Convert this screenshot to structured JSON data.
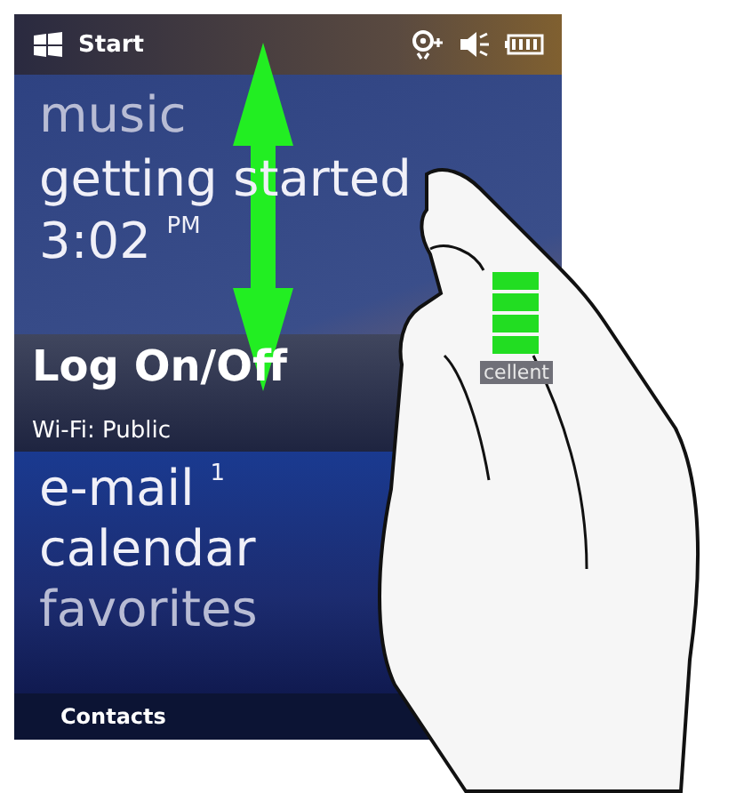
{
  "status_bar": {
    "title": "Start"
  },
  "items": [
    {
      "kind": "dim",
      "label": "music"
    },
    {
      "kind": "large",
      "label": "getting started"
    },
    {
      "kind": "time",
      "label": "3:02 $^{PM}$"
    },
    {
      "kind": "bold",
      "label": "Log On/Off"
    },
    {
      "kind": "small",
      "label": "Wi-Fi: Public"
    },
    {
      "kind": "large",
      "label": "e-mail $^{1}$"
    },
    {
      "kind": "large",
      "label": "calendar"
    },
    {
      "kind": "dim",
      "label": "favorites"
    }
  ],
  "signal": {
    "label": "cellent"
  },
  "soft_keys": [
    "Contacts"
  ]
}
